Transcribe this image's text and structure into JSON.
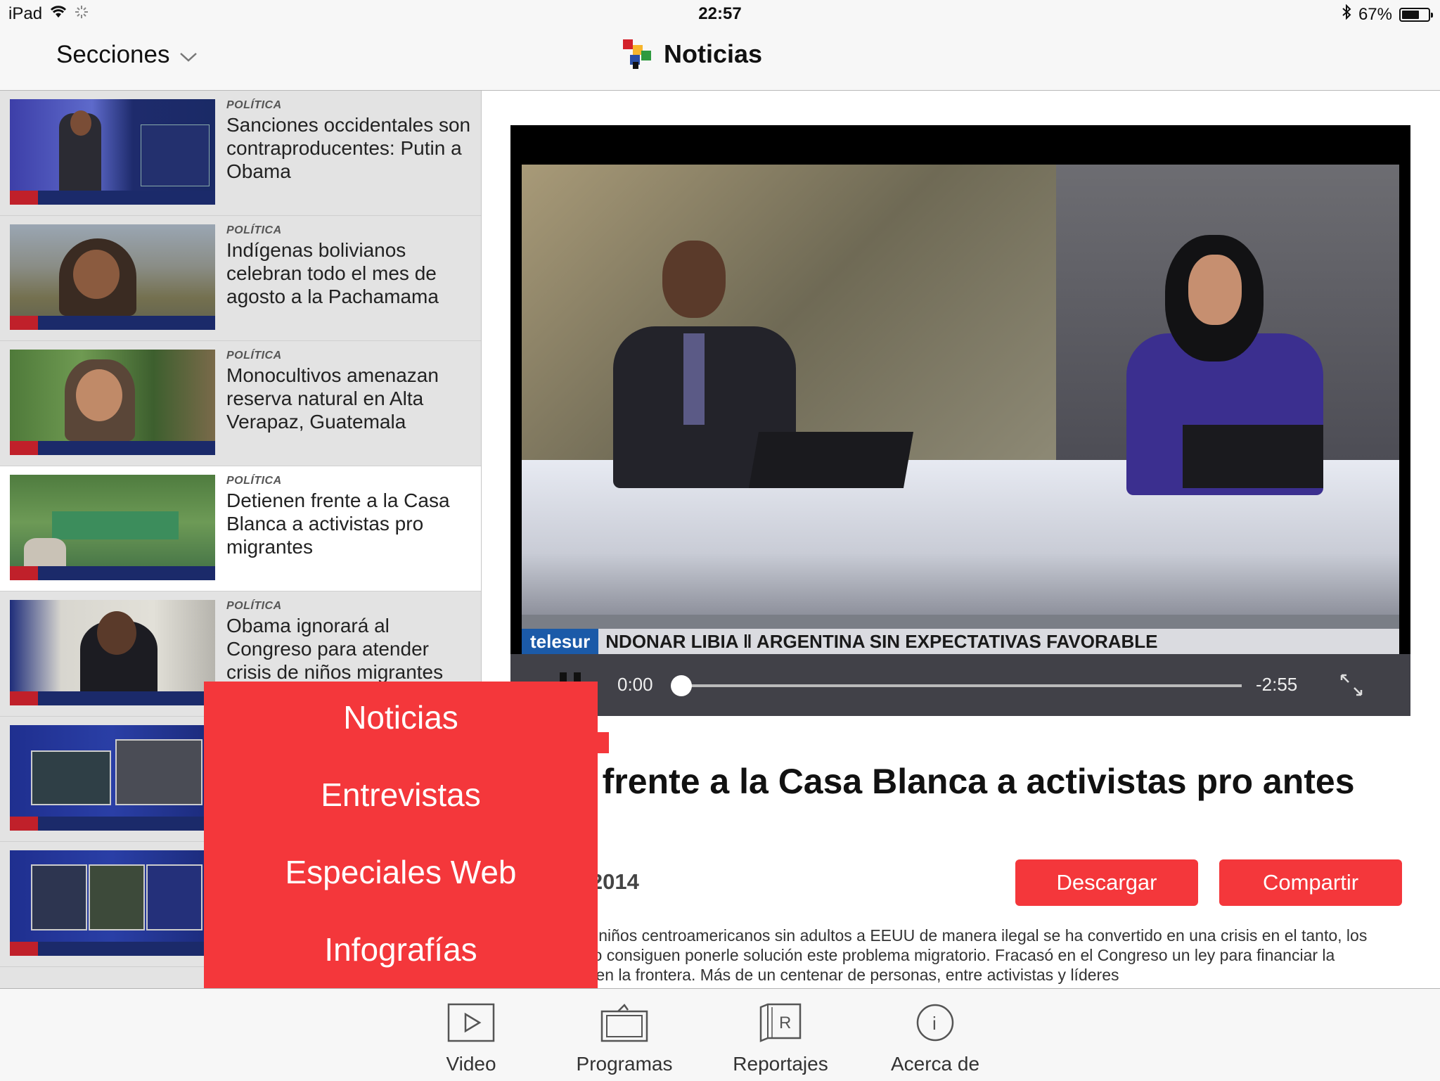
{
  "status_bar": {
    "device": "iPad",
    "time": "22:57",
    "battery_label": "67%",
    "battery_level": 0.67
  },
  "nav": {
    "sections_label": "Secciones",
    "title": "Noticias"
  },
  "list": [
    {
      "category": "POLÍTICA",
      "headline": "Sanciones occidentales son contraproducentes: Putin a Obama",
      "selected": false
    },
    {
      "category": "POLÍTICA",
      "headline": "Indígenas bolivianos celebran todo el mes de agosto a la Pachamama",
      "selected": false
    },
    {
      "category": "POLÍTICA",
      "headline": "Monocultivos amenazan reserva natural en Alta Verapaz, Guatemala",
      "selected": false
    },
    {
      "category": "POLÍTICA",
      "headline": "Detienen frente a la Casa Blanca a activistas pro migrantes",
      "selected": true
    },
    {
      "category": "POLÍTICA",
      "headline": "Obama ignorará al Congreso para atender crisis de niños migrantes",
      "selected": false
    },
    {
      "category": "",
      "headline": "",
      "selected": false
    },
    {
      "category": "",
      "headline": "",
      "selected": false
    }
  ],
  "player": {
    "elapsed": "0:00",
    "remaining": "-2:55",
    "progress": 0.0,
    "ticker_brand": "telesur",
    "ticker_text": "NDONAR LIBIA  ‖  ARGENTINA SIN EXPECTATIVAS FAVORABLE"
  },
  "article": {
    "title_partial": "enen frente a la Casa Blanca a activistas pro antes",
    "date_partial": "sto de 2014",
    "download_label": "Descargar",
    "share_label": "Compartir",
    "body_partial": "masiva de niños centroamericanos sin adultos a EEUU de manera ilegal se ha convertido en una crisis en el tanto, los políticos no consiguen ponerle solución este problema migratorio. Fracasó en el Congreso un ley para financiar la seguridad en la frontera. Más de un centenar de personas, entre activistas y líderes"
  },
  "sections_menu": [
    "Noticias",
    "Entrevistas",
    "Especiales Web",
    "Infografías"
  ],
  "tabs": [
    {
      "label": "Video",
      "icon": "play-icon"
    },
    {
      "label": "Programas",
      "icon": "tv-icon"
    },
    {
      "label": "Reportajes",
      "icon": "reportajes-icon"
    },
    {
      "label": "Acerca de",
      "icon": "info-icon"
    }
  ],
  "colors": {
    "accent": "#f4373b",
    "list_bg": "#e3e3e3",
    "bar_bg": "#f7f7f7"
  }
}
